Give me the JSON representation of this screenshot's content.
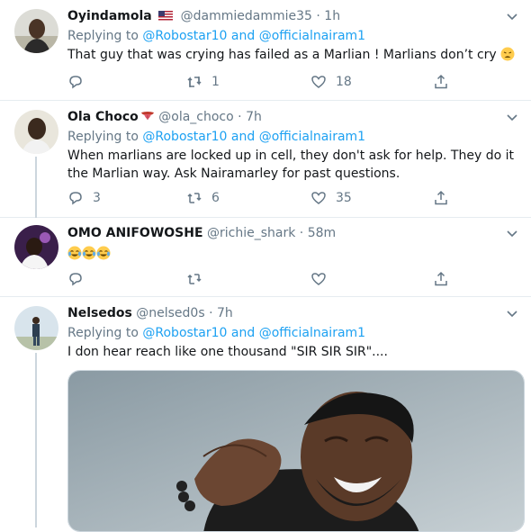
{
  "tweets": [
    {
      "name": "Oyindamola",
      "flag": "us-flag",
      "handle": "@dammiedammie35",
      "time": "1h",
      "replying": "Replying to ",
      "mention1": "@Robostar10",
      "and": " and ",
      "mention2": "@officialnairam1",
      "text": "That guy that was crying has failed as a Marlian ! Marlians don’t cry",
      "emoji": "weary-face-icon",
      "replies": "",
      "retweets": "1",
      "likes": "18"
    },
    {
      "name": "Ola Choco",
      "name_emoji": "tongue-icon",
      "handle": "@ola_choco",
      "time": "7h",
      "replying": "Replying to ",
      "mention1": "@Robostar10",
      "and": " and ",
      "mention2": "@officialnairam1",
      "text": "When marlians are locked up in cell, they don't ask for help. They do it the Marlian way. Ask Nairamarley for past questions.",
      "replies": "3",
      "retweets": "6",
      "likes": "35"
    },
    {
      "name": "OMO ANIFOWOSHE",
      "handle": "@richie_shark",
      "time": "58m",
      "text_emojis": "tears-of-joy-icons",
      "replies": "",
      "retweets": "",
      "likes": ""
    },
    {
      "name": "Nelsedos",
      "handle": "@nelsed0s",
      "time": "7h",
      "replying": "Replying to ",
      "mention1": "@Robostar10",
      "and": " and ",
      "mention2": "@officialnairam1",
      "text": "I don hear reach like one thousand \"SIR SIR SIR\"...."
    }
  ],
  "dot": "·",
  "colors": {
    "link": "#1da1f2",
    "muted": "#657786",
    "border": "#e6ecf0"
  }
}
